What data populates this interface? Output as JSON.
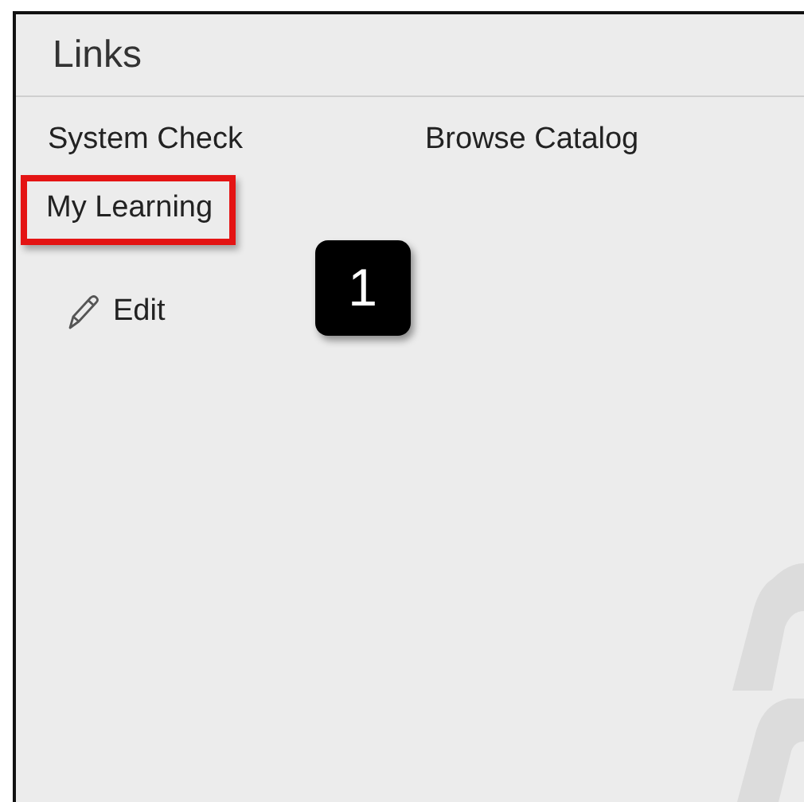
{
  "panel": {
    "title": "Links"
  },
  "links": [
    {
      "label": "System Check",
      "highlighted": false
    },
    {
      "label": "Browse Catalog",
      "highlighted": false
    },
    {
      "label": "My Learning",
      "highlighted": true
    }
  ],
  "callout": {
    "label": "1"
  },
  "edit": {
    "label": "Edit"
  }
}
